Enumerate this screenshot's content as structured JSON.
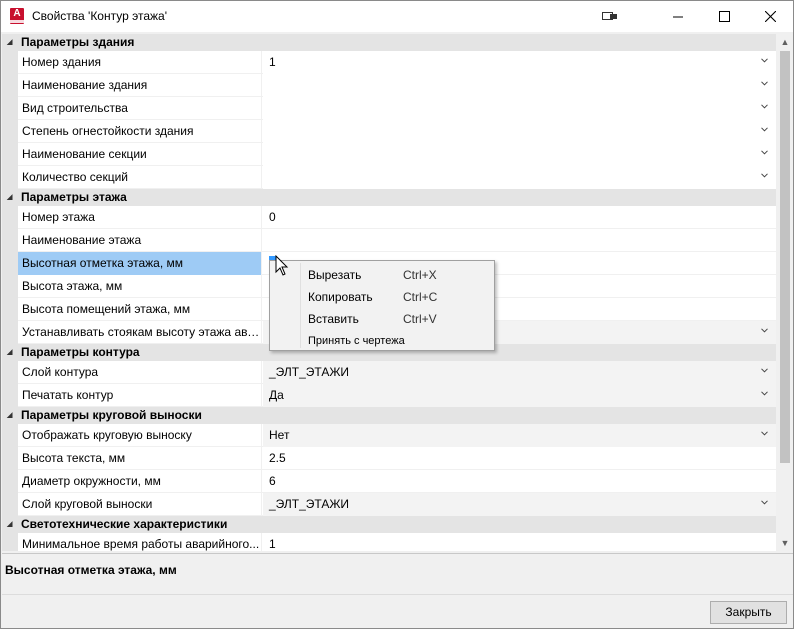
{
  "window": {
    "title": "Свойства 'Контур этажа'",
    "app_icon_letter": "A"
  },
  "categories": [
    {
      "label": "Параметры здания",
      "rows": [
        {
          "name": "Номер здания",
          "value": "1",
          "dropdown": true,
          "shaded": false
        },
        {
          "name": "Наименование здания",
          "value": "",
          "dropdown": true,
          "shaded": false
        },
        {
          "name": "Вид строительства",
          "value": "",
          "dropdown": true,
          "shaded": false
        },
        {
          "name": "Степень огнестойкости здания",
          "value": "",
          "dropdown": true,
          "shaded": false
        },
        {
          "name": "Наименование секции",
          "value": "",
          "dropdown": true,
          "shaded": false
        },
        {
          "name": "Количество секций",
          "value": "",
          "dropdown": true,
          "shaded": false
        }
      ]
    },
    {
      "label": "Параметры этажа",
      "rows": [
        {
          "name": "Номер этажа",
          "value": "0",
          "dropdown": false
        },
        {
          "name": "Наименование этажа",
          "value": "",
          "dropdown": false
        },
        {
          "name": "Высотная отметка этажа, мм",
          "value": "",
          "dropdown": false,
          "selected": true
        },
        {
          "name": "Высота этажа, мм",
          "value": "",
          "dropdown": false
        },
        {
          "name": "Высота помещений этажа, мм",
          "value": "",
          "dropdown": false
        },
        {
          "name": "Устанавливать стоякам высоту этажа авто...",
          "value": "",
          "dropdown": true,
          "shaded": true
        }
      ]
    },
    {
      "label": "Параметры контура",
      "rows": [
        {
          "name": "Слой контура",
          "value": "_ЭЛТ_ЭТАЖИ",
          "dropdown": true,
          "shaded": true
        },
        {
          "name": "Печатать контур",
          "value": "Да",
          "dropdown": true,
          "shaded": true
        }
      ]
    },
    {
      "label": "Параметры круговой выноски",
      "rows": [
        {
          "name": "Отображать круговую выноску",
          "value": "Нет",
          "dropdown": true,
          "shaded": true
        },
        {
          "name": "Высота текста, мм",
          "value": "2.5",
          "dropdown": false
        },
        {
          "name": "Диаметр окружности, мм",
          "value": "6",
          "dropdown": false
        },
        {
          "name": "Слой круговой выноски",
          "value": "_ЭЛТ_ЭТАЖИ",
          "dropdown": true,
          "shaded": true
        }
      ]
    },
    {
      "label": "Светотехнические характеристики",
      "rows": [
        {
          "name": "Минимальное время работы аварийного...",
          "value": "1",
          "dropdown": false
        }
      ]
    }
  ],
  "description": "Высотная отметка этажа, мм",
  "context_menu": {
    "items": [
      {
        "label": "Вырезать",
        "shortcut": "Ctrl+X"
      },
      {
        "label": "Копировать",
        "shortcut": "Ctrl+C"
      },
      {
        "label": "Вставить",
        "shortcut": "Ctrl+V"
      },
      {
        "label": "Принять с чертежа",
        "shortcut": ""
      }
    ]
  },
  "buttons": {
    "close": "Закрыть"
  },
  "icons": {
    "collapse": "triangle-down-right-icon",
    "dropdown": "chevron-down-icon",
    "minimize": "minimize-icon",
    "maximize": "maximize-icon",
    "close": "close-icon"
  },
  "colors": {
    "selection": "#9ecbf5",
    "category_bg": "#e4e4e4",
    "app_icon": "#c8102e"
  }
}
